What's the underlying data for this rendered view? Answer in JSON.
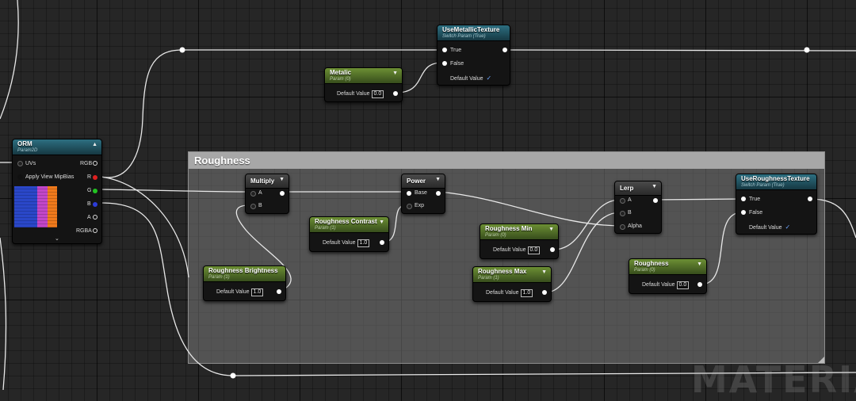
{
  "comment": {
    "title": "Roughness"
  },
  "watermark": "MATERIAL",
  "orm": {
    "title": "ORM",
    "subtitle": "Param2D",
    "inputs": [
      "UVs",
      "Apply View MipBias"
    ],
    "outputs": [
      "RGB",
      "R",
      "G",
      "B",
      "A",
      "RGBA"
    ],
    "collapse_icon": "chevron-down-icon"
  },
  "use_metallic": {
    "title": "UseMetallicTexture",
    "subtitle": "Switch Param (True)",
    "true_label": "True",
    "false_label": "False",
    "default_label": "Default Value"
  },
  "metalic": {
    "title": "Metalic",
    "subtitle": "Param (0)",
    "default_label": "Default Value",
    "value": "0.0"
  },
  "multiply": {
    "title": "Multiply",
    "a_label": "A",
    "b_label": "B"
  },
  "power": {
    "title": "Power",
    "base_label": "Base",
    "exp_label": "Exp"
  },
  "lerp": {
    "title": "Lerp",
    "a_label": "A",
    "b_label": "B",
    "alpha_label": "Alpha"
  },
  "use_roughness": {
    "title": "UseRoughnessTexture",
    "subtitle": "Switch Param (True)",
    "true_label": "True",
    "false_label": "False",
    "default_label": "Default Value"
  },
  "roughness_contrast": {
    "title": "Roughness Contrast",
    "subtitle": "Param (1)",
    "default_label": "Default Value",
    "value": "1.0"
  },
  "roughness_min": {
    "title": "Roughness Min",
    "subtitle": "Param (0)",
    "default_label": "Default Value",
    "value": "0.0"
  },
  "roughness_brightness": {
    "title": "Roughness Brightness",
    "subtitle": "Param (1)",
    "default_label": "Default Value",
    "value": "1.0"
  },
  "roughness_max": {
    "title": "Roughness Max",
    "subtitle": "Param (1)",
    "default_label": "Default Value",
    "value": "1.0"
  },
  "roughness": {
    "title": "Roughness",
    "subtitle": "Param (0)",
    "default_label": "Default Value",
    "value": "0.0"
  },
  "colors": {
    "param_header": "#5a7a2c",
    "switch_header": "#235d6e",
    "pin_r": "#e02020",
    "pin_g": "#22c322",
    "pin_b": "#2d3cd8",
    "check": "#6ea6ff"
  }
}
